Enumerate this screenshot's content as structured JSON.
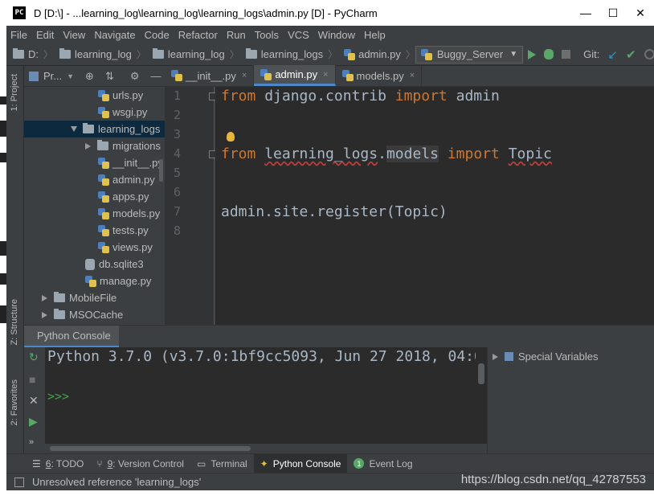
{
  "window": {
    "title": "D [D:\\] - ...learning_log\\learning_log\\learning_logs\\admin.py [D] - PyCharm",
    "logo_text": "PC",
    "controls": {
      "minimize": "—",
      "maximize": "☐",
      "close": "✕"
    }
  },
  "menu": [
    "File",
    "Edit",
    "View",
    "Navigate",
    "Code",
    "Refactor",
    "Run",
    "Tools",
    "VCS",
    "Window",
    "Help"
  ],
  "breadcrumb": [
    "D:",
    "learning_log",
    "learning_log",
    "learning_logs",
    "admin.py"
  ],
  "run_config": "Buggy_Server",
  "git_label": "Git:",
  "side_tabs": {
    "project": "1: Project",
    "structure": "Z: Structure",
    "favorites": "2: Favorites"
  },
  "project_panel": {
    "title": "Pr...",
    "tree": [
      {
        "label": "urls.py",
        "type": "py"
      },
      {
        "label": "wsgi.py",
        "type": "py"
      },
      {
        "label": "learning_logs",
        "type": "folder-open"
      },
      {
        "label": "migrations",
        "type": "folder-closed"
      },
      {
        "label": "__init__.py",
        "type": "py"
      },
      {
        "label": "admin.py",
        "type": "py"
      },
      {
        "label": "apps.py",
        "type": "py"
      },
      {
        "label": "models.py",
        "type": "py"
      },
      {
        "label": "tests.py",
        "type": "py"
      },
      {
        "label": "views.py",
        "type": "py"
      },
      {
        "label": "db.sqlite3",
        "type": "db"
      },
      {
        "label": "manage.py",
        "type": "py"
      },
      {
        "label": "MobileFile",
        "type": "folder-closed"
      },
      {
        "label": "MSOCache",
        "type": "folder-closed"
      }
    ]
  },
  "tabs": [
    {
      "label": "__init__.py"
    },
    {
      "label": "admin.py"
    },
    {
      "label": "models.py"
    }
  ],
  "tab_close": "×",
  "editor": {
    "line_numbers": [
      "1",
      "2",
      "3",
      "4",
      "5",
      "6",
      "7",
      "8"
    ],
    "line1": {
      "kw1": "from",
      "mod": " django.contrib ",
      "kw2": "import",
      "name": " admin"
    },
    "line4": {
      "kw1": "from",
      "mod": "learning_logs",
      "dot": ".",
      "sub": "models",
      "kw2": "import",
      "name": "Topic"
    },
    "line7": "admin.site.register(Topic)"
  },
  "console": {
    "tab": "Python Console",
    "output_line": "Python 3.7.0 (v3.7.0:1bf9cc5093, Jun 27 2018, 04:0",
    "prompt": ">>>",
    "special_variables": "Special Variables"
  },
  "tool_windows": [
    {
      "num": "6",
      "label": ": TODO"
    },
    {
      "num": "9",
      "label": ": Version Control"
    },
    {
      "num": "",
      "label": "Terminal"
    },
    {
      "num": "",
      "label": "Python Console"
    },
    {
      "num": "",
      "label": "Event Log"
    }
  ],
  "status": "Unresolved reference 'learning_logs'",
  "watermark": "https://blog.csdn.net/qq_42787553"
}
